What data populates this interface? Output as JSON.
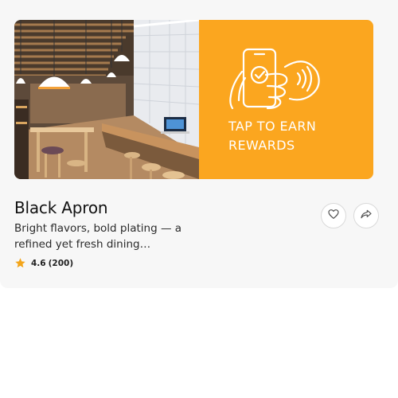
{
  "banner": {
    "promo_line_1": "TAP TO EARN",
    "promo_line_2": "REWARDS",
    "promo_icon": "tap-phone-icon",
    "promo_color": "#fba61f"
  },
  "restaurant": {
    "name": "Black Apron",
    "description": "Bright flavors, bold plating — a refined yet fresh dining…",
    "rating": "4.6",
    "rating_count": "(200)"
  },
  "actions": {
    "favorite_icon": "heart-icon",
    "share_icon": "share-icon"
  },
  "colors": {
    "star": "#f3a51b",
    "text_primary": "#111111",
    "card_background": "#f7f7f7"
  }
}
